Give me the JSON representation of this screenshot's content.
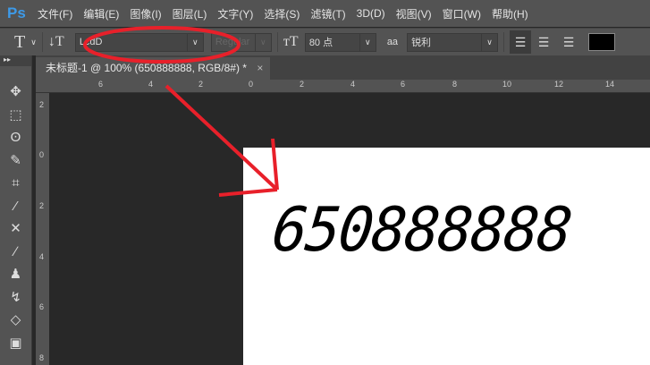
{
  "menubar": {
    "logo": "Ps",
    "items": [
      "文件(F)",
      "编辑(E)",
      "图像(I)",
      "图层(L)",
      "文字(Y)",
      "选择(S)",
      "滤镜(T)",
      "3D(D)",
      "视图(V)",
      "窗口(W)",
      "帮助(H)"
    ]
  },
  "options": {
    "tool": "T",
    "font_family": "LcdD",
    "font_style": "Regular",
    "font_size": "80 点",
    "antialias_icon": "aa",
    "antialias": "锐利",
    "color": "#000000"
  },
  "document": {
    "tab_title": "未标题-1 @ 100% (650888888, RGB/8#) *",
    "close": "×",
    "text": "650888888"
  },
  "rulers": {
    "horizontal": [
      "6",
      "4",
      "2",
      "0",
      "2",
      "4",
      "6",
      "8",
      "10",
      "12",
      "14"
    ],
    "vertical": [
      "2",
      "0",
      "2",
      "4",
      "6",
      "8"
    ]
  },
  "annotation_color": "#e8202a"
}
